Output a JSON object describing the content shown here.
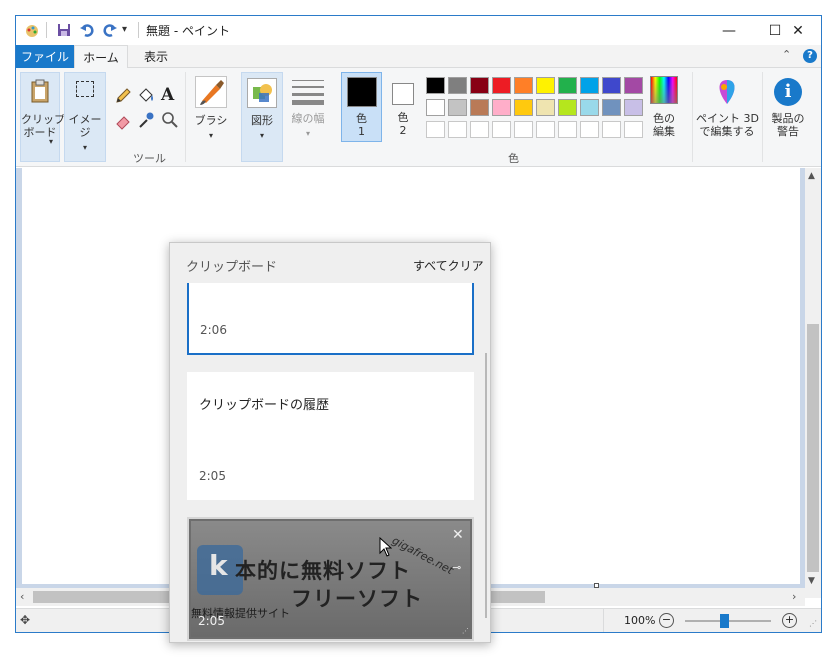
{
  "window": {
    "title": "無題 - ペイント",
    "minimize": "—",
    "maximize": "☐",
    "close": "✕"
  },
  "tabs": {
    "file": "ファイル",
    "home": "ホーム",
    "view": "表示"
  },
  "ribbon": {
    "clipboard_label": "クリップ\nボード",
    "image_label": "イメージ",
    "tools_label": "ツール",
    "brush_label": "ブラシ",
    "shapes_label": "図形",
    "size_label": "線の幅",
    "color1_label": "色",
    "color1_num": "1",
    "color2_label": "色",
    "color2_num": "2",
    "colors_group_label": "色",
    "edit_colors_label": "色の\n編集",
    "paint3d_label": "ペイント 3D\nで編集する",
    "product_alert_label": "製品の\n警告",
    "palette_row1": [
      "#000000",
      "#7f7f7f",
      "#880015",
      "#ed1c24",
      "#ff7f27",
      "#fff200",
      "#22b14c",
      "#00a2e8",
      "#3f48cc",
      "#a349a4"
    ],
    "palette_row2": [
      "#ffffff",
      "#c3c3c3",
      "#b97a57",
      "#ffaec9",
      "#ffc90e",
      "#efe4b0",
      "#b5e61d",
      "#99d9ea",
      "#7092be",
      "#c8bfe7"
    ],
    "color1_value": "#000000",
    "color2_value": "#ffffff"
  },
  "clipboard_panel": {
    "title": "クリップボード",
    "clear_all": "すべてクリア",
    "items": [
      {
        "text": "",
        "time": "2:06"
      },
      {
        "text": "クリップボードの履歴",
        "time": "2:05"
      },
      {
        "image_text_1": "本的に無料ソフト",
        "image_text_2": "フリーソフト",
        "image_text_3": "無料情報提供サイト",
        "image_text_4": "gigafree.net",
        "time": "2:05"
      }
    ]
  },
  "status": {
    "zoom": "100%",
    "zoom_out": "−",
    "zoom_in": "+",
    "zoom_fraction": 0.45
  }
}
